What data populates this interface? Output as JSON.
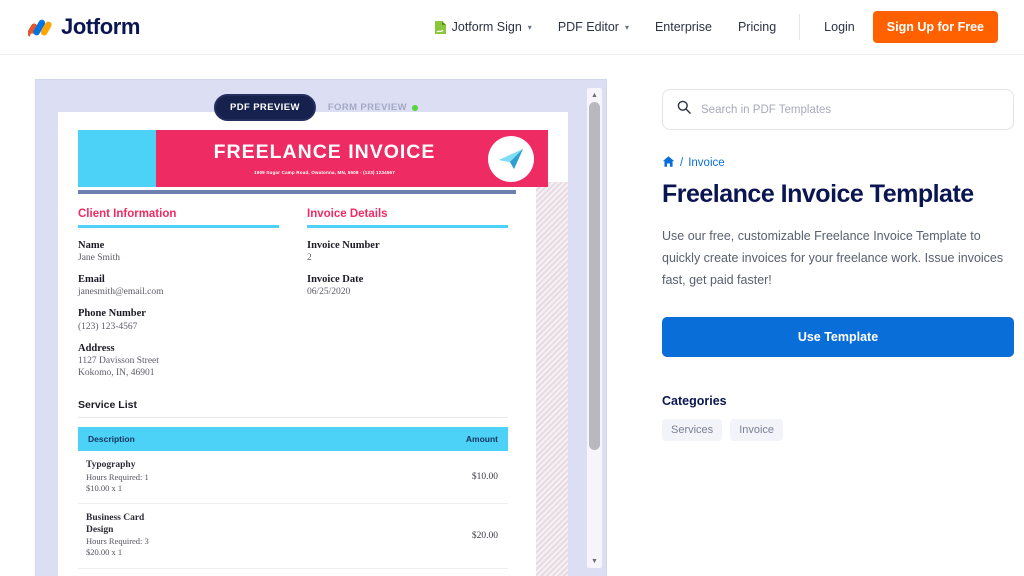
{
  "header": {
    "brand": "Jotform",
    "nav": [
      {
        "label": "Jotform Sign",
        "icon": "sign-document-icon",
        "caret": "▾"
      },
      {
        "label": "PDF Editor",
        "icon": null,
        "caret": "▾"
      },
      {
        "label": "Enterprise",
        "icon": null,
        "caret": ""
      },
      {
        "label": "Pricing",
        "icon": null,
        "caret": ""
      }
    ],
    "login_label": "Login",
    "signup_label": "Sign Up for Free"
  },
  "preview": {
    "tab_pdf": "PDF PREVIEW",
    "tab_form": "FORM PREVIEW",
    "document": {
      "banner_title": "FREELANCE INVOICE",
      "banner_address": "1909 Sugar Camp Road, Owatonna, MN, 5508 - (123) 1234567",
      "client_section": {
        "title": "Client Information",
        "fields": [
          {
            "label": "Name",
            "value": "Jane Smith"
          },
          {
            "label": "Email",
            "value": "janesmith@email.com"
          },
          {
            "label": "Phone Number",
            "value": "(123) 123-4567"
          },
          {
            "label": "Address",
            "value": "1127 Davisson Street\nKokomo, IN, 46901"
          }
        ]
      },
      "invoice_section": {
        "title": "Invoice Details",
        "fields": [
          {
            "label": "Invoice Number",
            "value": "2"
          },
          {
            "label": "Invoice Date",
            "value": "06/25/2020"
          }
        ]
      },
      "service_list": {
        "title": "Service List",
        "columns": [
          "Description",
          "Amount"
        ],
        "rows": [
          {
            "name": "Typography",
            "hours": "Hours Required: 1",
            "rate": "$10.00 x 1",
            "amount": "$10.00"
          },
          {
            "name": "Business Card Design",
            "hours": "Hours Required: 3",
            "rate": "$20.00 x 1",
            "amount": "$20.00"
          }
        ]
      }
    }
  },
  "sidebar": {
    "search_placeholder": "Search in PDF Templates",
    "search_value": "",
    "breadcrumb": {
      "home_icon": "home-icon",
      "separator": "/",
      "current": "Invoice"
    },
    "page_title": "Freelance Invoice Template",
    "description": "Use our free, customizable Freelance Invoice Template to quickly create invoices for your freelance work. Issue invoices fast, get paid faster!",
    "use_template_label": "Use Template",
    "categories_title": "Categories",
    "categories": [
      "Services",
      "Invoice"
    ]
  },
  "colors": {
    "brand_navy": "#0a1551",
    "accent_orange": "#ff6100",
    "accent_blue": "#0a6ed8",
    "invoice_pink": "#ef2b63",
    "invoice_cyan": "#4cd2f7",
    "preview_bg": "#dcdef3",
    "status_green": "#55d43f"
  }
}
